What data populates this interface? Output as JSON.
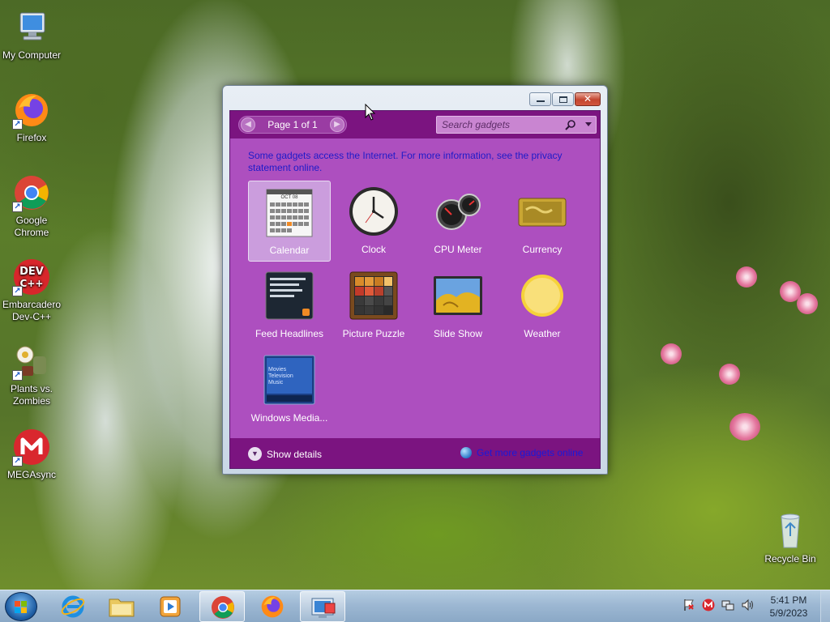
{
  "desktop": {
    "icons": [
      {
        "label": "My Computer",
        "icon": "computer-icon"
      },
      {
        "label": "Firefox",
        "icon": "firefox-icon"
      },
      {
        "label": "Google Chrome",
        "icon": "chrome-icon"
      },
      {
        "label": "Embarcadero Dev-C++",
        "icon": "devcpp-icon",
        "badge": "DEV\nC++"
      },
      {
        "label": "Plants vs. Zombies",
        "icon": "plants-vs-zombies-icon"
      },
      {
        "label": "MEGAsync",
        "icon": "mega-icon",
        "badge": "M"
      },
      {
        "label": "Recycle Bin",
        "icon": "recycle-bin-icon"
      }
    ]
  },
  "gadget_window": {
    "pager": {
      "label": "Page 1 of 1"
    },
    "search": {
      "placeholder": "Search gadgets"
    },
    "notice": "Some gadgets access the Internet.  For more information, see the privacy statement online.",
    "gadgets": [
      {
        "label": "Calendar",
        "icon": "calendar-icon",
        "selected": true,
        "month": "OCT 08"
      },
      {
        "label": "Clock",
        "icon": "clock-icon"
      },
      {
        "label": "CPU Meter",
        "icon": "cpu-meter-icon"
      },
      {
        "label": "Currency",
        "icon": "currency-icon"
      },
      {
        "label": "Feed Headlines",
        "icon": "feed-headlines-icon"
      },
      {
        "label": "Picture Puzzle",
        "icon": "picture-puzzle-icon"
      },
      {
        "label": "Slide Show",
        "icon": "slide-show-icon"
      },
      {
        "label": "Weather",
        "icon": "weather-icon"
      },
      {
        "label": "Windows Media...",
        "icon": "windows-media-icon",
        "menu": [
          "Movies",
          "Television",
          "Music"
        ]
      }
    ],
    "show_details": "Show details",
    "get_more": "Get more gadgets online"
  },
  "taskbar": {
    "buttons": [
      {
        "name": "internet-explorer",
        "icon": "internet-explorer-icon"
      },
      {
        "name": "file-explorer",
        "icon": "folder-icon"
      },
      {
        "name": "media-player",
        "icon": "media-player-icon"
      },
      {
        "name": "chrome",
        "icon": "chrome-icon",
        "active": true
      },
      {
        "name": "firefox",
        "icon": "firefox-icon"
      },
      {
        "name": "gadgets",
        "icon": "gadgets-icon",
        "active": true
      }
    ],
    "tray": [
      "flag-icon",
      "mega-icon",
      "network-icon",
      "volume-icon"
    ],
    "time": "5:41 PM",
    "date": "5/9/2023"
  },
  "colors": {
    "gadget_panel": "#ad4fbf",
    "gadget_bar": "#7b1480",
    "notice_text": "#1e1bc8",
    "taskbar": "#9db8d3"
  }
}
